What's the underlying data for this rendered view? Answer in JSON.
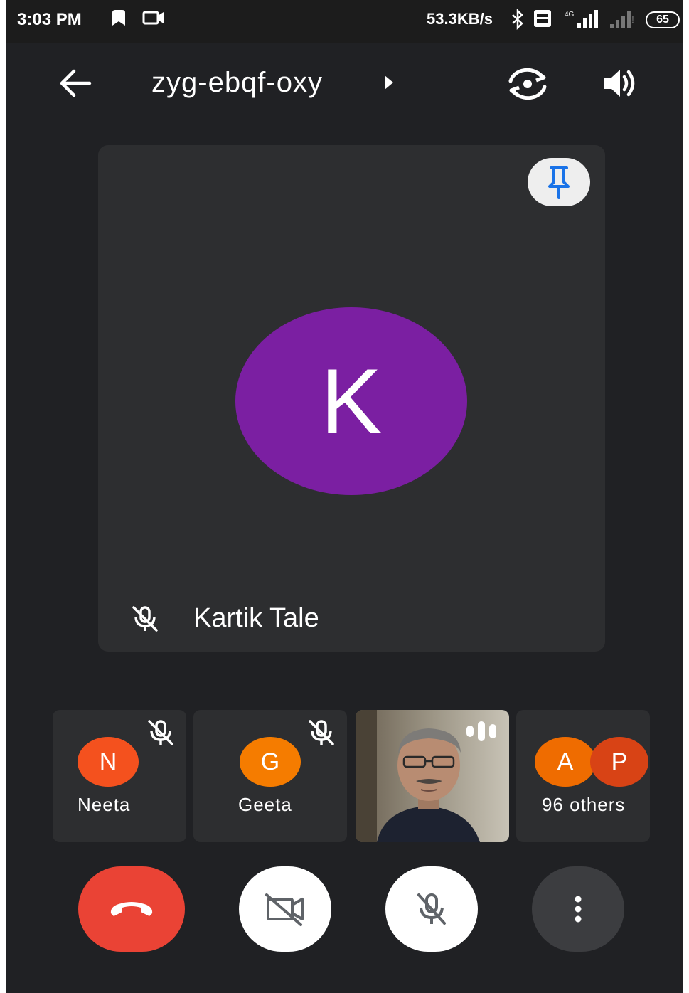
{
  "status_bar": {
    "time": "3:03 PM",
    "network_speed": "53.3KB/s",
    "battery_level": "65",
    "icons": [
      "notification-icon",
      "video-call-icon",
      "bluetooth-icon",
      "volte-icon",
      "signal-4g-icon",
      "signal-icon"
    ]
  },
  "top_bar": {
    "meeting_code": "zyg-ebqf-oxy",
    "back_icon": "arrow-left-icon",
    "switch_camera_icon": "camera-switch-icon",
    "speaker_icon": "speaker-icon"
  },
  "main_tile": {
    "initial": "K",
    "avatar_color": "#7b1fa2",
    "participant_name": "Kartik Tale",
    "pin_icon": "pin-icon",
    "mic_status": "muted"
  },
  "participants": [
    {
      "initial": "N",
      "name": "Neeta",
      "avatar_color": "#f4511e",
      "mic_status": "muted"
    },
    {
      "initial": "G",
      "name": "Geeta",
      "avatar_color": "#f57c00",
      "mic_status": "muted"
    },
    {
      "name": "",
      "type": "video",
      "speaking": true
    },
    {
      "initials": [
        "A",
        "P"
      ],
      "avatar_colors": [
        "#ef6c00",
        "#d84315"
      ],
      "label": "96 others"
    }
  ],
  "controls": {
    "end_call_color": "#ea4335",
    "items": [
      "end-call",
      "camera-off",
      "mic-off",
      "more-options"
    ]
  }
}
